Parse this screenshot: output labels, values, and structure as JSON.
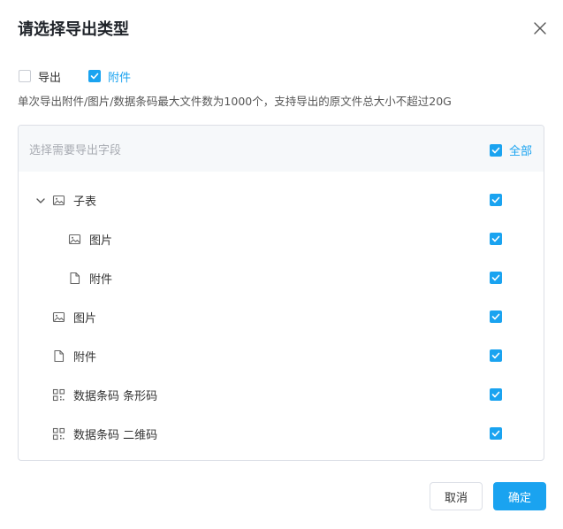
{
  "dialog": {
    "title": "请选择导出类型",
    "close_icon": "close-icon"
  },
  "export_type": {
    "options": [
      {
        "label": "导出",
        "checked": false
      },
      {
        "label": "附件",
        "checked": true
      }
    ]
  },
  "hint": "单次导出附件/图片/数据条码最大文件数为1000个，支持导出的原文件总大小不超过20G",
  "field_panel": {
    "placeholder": "选择需要导出字段",
    "select_all": {
      "label": "全部",
      "checked": true
    },
    "rows": [
      {
        "label": "子表",
        "icon": "image-icon",
        "expanded": true,
        "checked": true
      },
      {
        "label": "图片",
        "icon": "image-icon",
        "checked": true
      },
      {
        "label": "附件",
        "icon": "file-icon",
        "checked": true
      },
      {
        "label": "图片",
        "icon": "image-icon",
        "checked": true
      },
      {
        "label": "附件",
        "icon": "file-icon",
        "checked": true
      },
      {
        "label": "数据条码 条形码",
        "icon": "qrcode-icon",
        "checked": true
      },
      {
        "label": "数据条码 二维码",
        "icon": "qrcode-icon",
        "checked": true
      }
    ]
  },
  "footer": {
    "cancel_label": "取消",
    "ok_label": "确定"
  },
  "colors": {
    "accent": "#1aa3f0",
    "border": "#dcdfe6",
    "header_bg": "#f6f8fa"
  }
}
